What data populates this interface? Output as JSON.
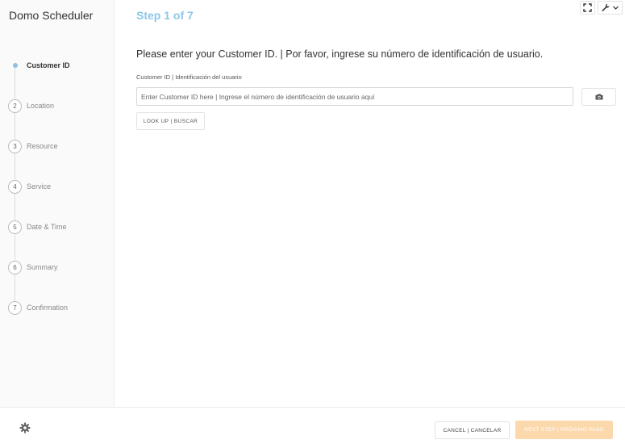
{
  "app": {
    "title": "Domo Scheduler"
  },
  "steps": [
    {
      "number": "1",
      "label": "Customer ID",
      "active": true
    },
    {
      "number": "2",
      "label": "Location",
      "active": false
    },
    {
      "number": "3",
      "label": "Resource",
      "active": false
    },
    {
      "number": "4",
      "label": "Service",
      "active": false
    },
    {
      "number": "5",
      "label": "Date & Time",
      "active": false
    },
    {
      "number": "6",
      "label": "Summary",
      "active": false
    },
    {
      "number": "7",
      "label": "Confirmation",
      "active": false
    }
  ],
  "main": {
    "step_title": "Step 1 of 7",
    "prompt": "Please enter your Customer ID. | Por favor, ingrese su número de identificación de usuario.",
    "field_label": "Customer ID | Identificación del usuario",
    "input_value": "",
    "input_placeholder": "Enter Customer ID here | Ingrese el número de identificación de usuario aquí",
    "lookup_label": "LOOK UP | BUSCAR",
    "camera_icon": "camera-icon"
  },
  "toolbar": {
    "fullscreen_icon": "fullscreen-icon",
    "wrench_icon": "wrench-icon",
    "dropdown_icon": "chevron-down-icon"
  },
  "footer": {
    "settings_icon": "gear-icon",
    "cancel_label": "CANCEL | CANCELAR",
    "next_label": "NEXT STEP | PRÓXIMO PASO"
  },
  "colors": {
    "accent": "#8cc7ea",
    "next_button_disabled": "#fcd9ad"
  }
}
